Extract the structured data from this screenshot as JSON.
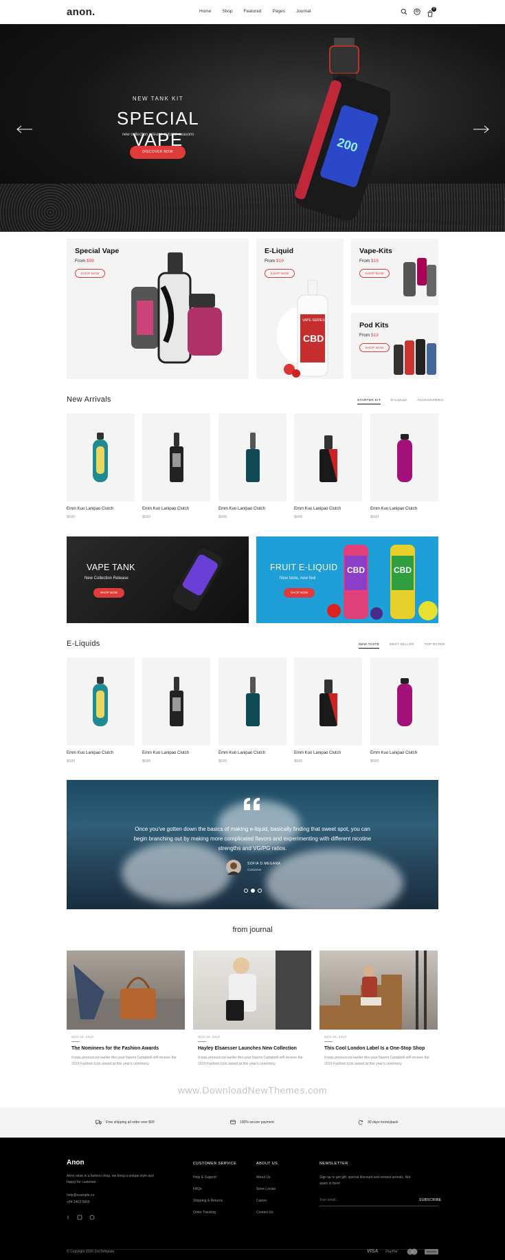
{
  "header": {
    "logo": "anon.",
    "nav": [
      "Home",
      "Shop",
      "Featured",
      "Pages",
      "Journal"
    ],
    "cart_count": "0"
  },
  "hero": {
    "subtitle": "NEW TANK KIT",
    "title": "SPECIAL VAPE",
    "description": "new collection release autumn seasons",
    "button": "DISCOVER NOW",
    "device_screen": "200"
  },
  "categories": [
    {
      "title": "Special Vape",
      "from": "From",
      "price": "$99",
      "button": "SHOP NOW"
    },
    {
      "title": "E-Liquid",
      "from": "From",
      "price": "$19",
      "button": "SHOP NOW",
      "label": "VAPE SERIES",
      "brand": "CBD"
    },
    {
      "title": "Vape-Kits",
      "from": "From",
      "price": "$19",
      "button": "SHOP NOW"
    },
    {
      "title": "Pod Kits",
      "from": "From",
      "price": "$19",
      "button": "SHOP NOW"
    }
  ],
  "new_arrivals": {
    "title": "New Arrivals",
    "tabs": [
      "STARTER KIT",
      "E-LIQUID",
      "ACCESSORIES"
    ],
    "products": [
      {
        "name": "Emm Kuo Lanipao Clutch",
        "price": "$689"
      },
      {
        "name": "Emm Kuo Lanipao Clutch",
        "price": "$689"
      },
      {
        "name": "Emm Kuo Lanipao Clutch",
        "price": "$689"
      },
      {
        "name": "Emm Kuo Lanipao Clutch",
        "price": "$689"
      },
      {
        "name": "Emm Kuo Lanipao Clutch",
        "price": "$689"
      }
    ]
  },
  "banners": [
    {
      "title": "VAPE TANK",
      "subtitle": "New Collection Release",
      "button": "SHOP NOW"
    },
    {
      "title": "FRUIT E-LIQUID",
      "subtitle": "New taste, new feel",
      "button": "SHOP NOW",
      "brand": "CBD"
    }
  ],
  "eliquids": {
    "title": "E-Liquids",
    "tabs": [
      "NEW TASTE",
      "BEST SELLER",
      "TOP RATED"
    ],
    "products": [
      {
        "name": "Emm Kuo Lanipao Clutch",
        "price": "$689"
      },
      {
        "name": "Emm Kuo Lanipao Clutch",
        "price": "$689"
      },
      {
        "name": "Emm Kuo Lanipao Clutch",
        "price": "$689"
      },
      {
        "name": "Emm Kuo Lanipao Clutch",
        "price": "$689"
      },
      {
        "name": "Emm Kuo Lanipao Clutch",
        "price": "$689"
      }
    ]
  },
  "testimonial": {
    "quote": "Once you've gotten down the basics of making e-liquid, basically finding that sweet spot, you can begin branching out by making more complicated flavors and experimenting with different nicotine strengths and VG/PG ratios.",
    "author": "SOFIA D.MEGANA",
    "role": "Customer"
  },
  "journal": {
    "title": "from journal",
    "posts": [
      {
        "date": "NOV 02, 2019",
        "title": "The Nominees for the Fashion Awards",
        "excerpt": "It was announced earlier this year Naomi Campbell will receive the 2019 Fashion Icon award at this year's ceremony"
      },
      {
        "date": "NOV 02, 2019",
        "title": "Hayley Elsaesser Launches New Collection",
        "excerpt": "It was announced earlier this year Naomi Campbell will receive the 2019 Fashion Icon award at this year's ceremony"
      },
      {
        "date": "NOV 03, 2019",
        "title": "This Cool London Label Is a One-Stop Shop",
        "excerpt": "It was announced earlier this year Naomi Campbell will receive the 2019 Fashion Icon award at this year's ceremony"
      }
    ]
  },
  "watermark": "www.DownloadNewThemes.com",
  "services": [
    "Free shipping all order over $99",
    "100% secure payment",
    "30 days moneyback"
  ],
  "footer": {
    "logo": "Anon",
    "about": "Anon store is a fashion shop, we bring a unique style and happy for customer.",
    "email": "help@example.co",
    "phone": "+84 1403 5869",
    "customer_service": {
      "title": "CUSTOMER SERVICE",
      "links": [
        "Help & Support",
        "FAQs",
        "Shipping & Returns",
        "Order Tracking"
      ]
    },
    "about_us": {
      "title": "ABOUT US",
      "links": [
        "About Us",
        "Store Locate",
        "Career",
        "Contact Us"
      ]
    },
    "newsletter": {
      "title": "NEWSLETTER",
      "text": "Sign up to get gift, special discount and newest arrivals. Not spam in here!",
      "placeholder": "Your email...",
      "button": "SUBSCRIBE"
    },
    "copyright": "© Copyright 2020 ZooTemplate",
    "payments": [
      "VISA",
      "PayPal"
    ]
  }
}
